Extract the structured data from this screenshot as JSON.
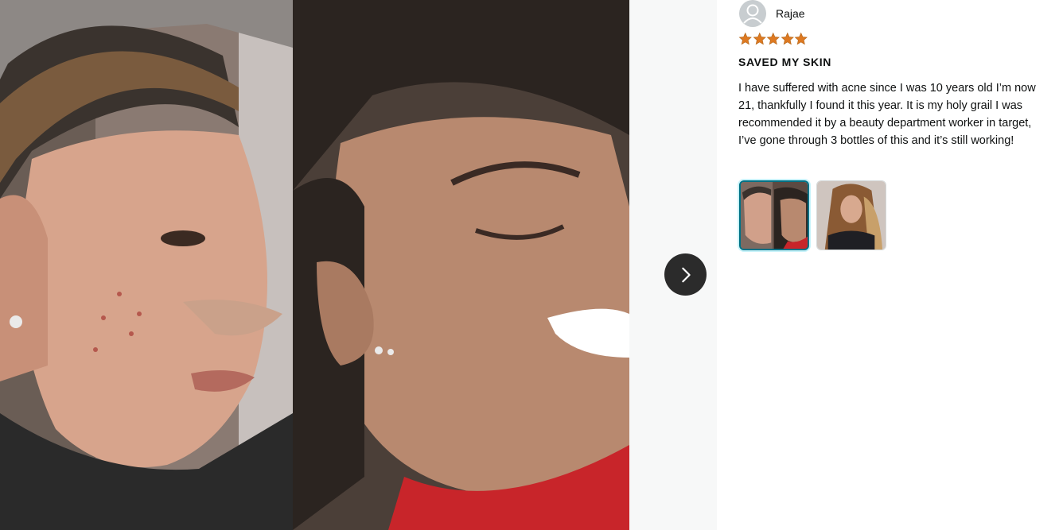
{
  "viewer": {
    "main_image_alt": "",
    "next_icon": "chevron-right-icon"
  },
  "review": {
    "reviewer_name": "Rajae",
    "rating": 5,
    "rating_max": 5,
    "title": "SAVED MY SKIN",
    "body": "I have suffered with acne since I was 10 years old I’m now 21, thankfully I found it this year. It is my holy grail I was recommended it by a beauty department worker in target, I’ve gone through 3 bottles of this and it’s still working!",
    "thumbnails": [
      {
        "selected": true
      },
      {
        "selected": false
      }
    ]
  },
  "colors": {
    "star": "#de7921",
    "selected_border": "#007185",
    "text": "#0f1111",
    "next_button_bg": "#2b2b2b"
  }
}
